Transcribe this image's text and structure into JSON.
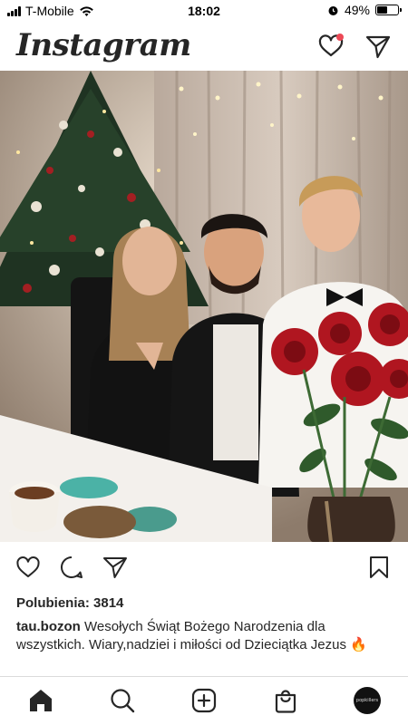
{
  "status_bar": {
    "carrier": "T-Mobile",
    "time": "18:02",
    "battery_percent": "49%",
    "battery_level": 0.49
  },
  "header": {
    "logo_text": "Instagram"
  },
  "post": {
    "likes_text": "Polubienia: 3814",
    "username": "tau.bozon",
    "caption_text": "Wesołych Świąt Bożego Narodzenia dla wszystkich. Wiary,nadziei i miłości od Dzieciątka Jezus",
    "caption_emoji": "🔥"
  },
  "profile": {
    "avatar_text": "popkillers"
  },
  "icons": {
    "heart": "heart-icon",
    "direct": "paper-plane-icon",
    "comment": "comment-icon",
    "share": "share-icon",
    "bookmark": "bookmark-icon",
    "home": "home-icon",
    "search": "search-icon",
    "create": "plus-square-icon",
    "shop": "shopping-bag-icon"
  }
}
